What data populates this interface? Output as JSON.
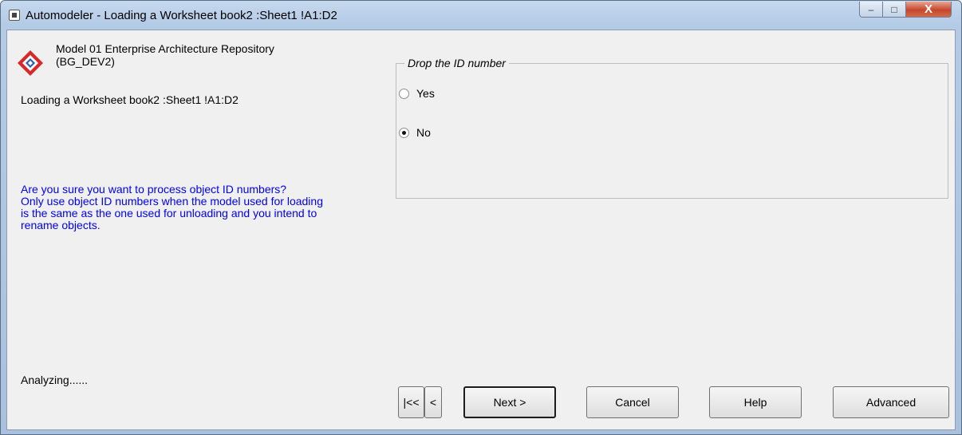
{
  "window": {
    "title": "Automodeler - Loading a Worksheet book2 :Sheet1 !A1:D2",
    "controls": {
      "minimize": "–",
      "maximize": "□",
      "close": "X"
    }
  },
  "info": {
    "model_line1": "Model 01 Enterprise Architecture Repository",
    "model_line2": "(BG_DEV2)",
    "loading_text": "Loading a Worksheet book2 :Sheet1 !A1:D2",
    "warning_lines": [
      "Are you sure you want to process object ID numbers?",
      "Only use object ID numbers when the model used for loading",
      "is the same as the one used for unloading and you intend to",
      "rename objects."
    ],
    "status_text": "Analyzing......"
  },
  "group": {
    "legend": "Drop the ID number",
    "options": [
      {
        "label": "Yes",
        "selected": false
      },
      {
        "label": "No",
        "selected": true
      }
    ]
  },
  "buttons": {
    "first": "|<<",
    "prev": "<",
    "next": "Next >",
    "cancel": "Cancel",
    "help": "Help",
    "advanced": "Advanced"
  },
  "colors": {
    "warning_text": "#0000ee",
    "close_button": "#c6472b",
    "logo_red": "#d42a2a",
    "logo_blue": "#2e5fb0"
  },
  "icons": {
    "app": "app-window-icon",
    "logo": "repository-logo-icon"
  }
}
